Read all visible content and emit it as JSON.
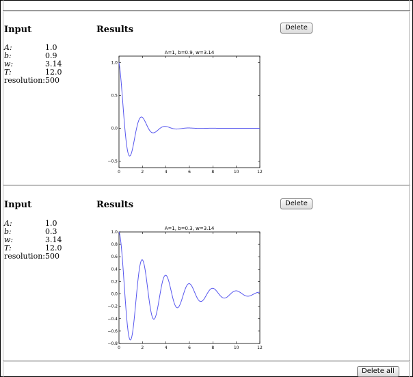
{
  "delete_all_label": "Delete all",
  "colors": {
    "curve": "#5555ee"
  },
  "entries": [
    {
      "input_heading": "Input",
      "results_heading": "Results",
      "delete_label": "Delete",
      "params": [
        {
          "key": "A:",
          "value": "1.0"
        },
        {
          "key": "b:",
          "value": "0.9"
        },
        {
          "key": "w:",
          "value": "3.14"
        },
        {
          "key": "T:",
          "value": "12.0"
        },
        {
          "key": "resolution:",
          "value": "500"
        }
      ],
      "chart_data": {
        "type": "line",
        "title": "A=1, b=0.9, w=3.14",
        "xlim": [
          0,
          12
        ],
        "ylim": [
          -0.6,
          1.1
        ],
        "xticks": [
          0,
          2,
          4,
          6,
          8,
          10,
          12
        ],
        "yticks": [
          1.0,
          0.5,
          0.0,
          -0.5
        ],
        "ytick_labels": [
          "1.0",
          "0.5",
          "0.0",
          "−0.5"
        ],
        "formula": {
          "A": 1.0,
          "b": 0.9,
          "w": 3.14,
          "T": 12.0,
          "resolution": 500
        }
      }
    },
    {
      "input_heading": "Input",
      "results_heading": "Results",
      "delete_label": "Delete",
      "params": [
        {
          "key": "A:",
          "value": "1.0"
        },
        {
          "key": "b:",
          "value": "0.3"
        },
        {
          "key": "w:",
          "value": "3.14"
        },
        {
          "key": "T:",
          "value": "12.0"
        },
        {
          "key": "resolution:",
          "value": "500"
        }
      ],
      "chart_data": {
        "type": "line",
        "title": "A=1, b=0.3, w=3.14",
        "xlim": [
          0,
          12
        ],
        "ylim": [
          -0.8,
          1.0
        ],
        "xticks": [
          0,
          2,
          4,
          6,
          8,
          10,
          12
        ],
        "yticks": [
          1.0,
          0.8,
          0.6,
          0.4,
          0.2,
          0.0,
          -0.2,
          -0.4,
          -0.6,
          -0.8
        ],
        "ytick_labels": [
          "1.0",
          "0.8",
          "0.6",
          "0.4",
          "0.2",
          "0.0",
          "−0.2",
          "−0.4",
          "−0.6",
          "−0.8"
        ],
        "formula": {
          "A": 1.0,
          "b": 0.3,
          "w": 3.14,
          "T": 12.0,
          "resolution": 500
        }
      }
    }
  ]
}
